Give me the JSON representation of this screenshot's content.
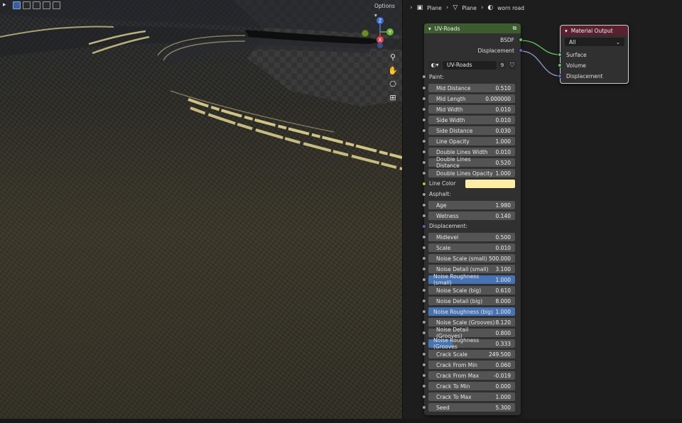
{
  "viewport": {
    "options_label": "Options",
    "gizmo_axes": {
      "z": "Z",
      "y": "Y",
      "x": "X"
    },
    "tool_icons": [
      "zoom-icon",
      "hand-icon",
      "camera-icon",
      "grid-icon"
    ]
  },
  "breadcrumb": {
    "object": "Plane",
    "mesh": "Plane",
    "material": "worn road"
  },
  "uv_node": {
    "title": "UV-Roads",
    "outputs": [
      "BSDF",
      "Displacement"
    ],
    "datablock_name": "UV-Roads",
    "datablock_users": "9",
    "section_paint": "Paint:",
    "paint_fields": [
      {
        "label": "Mid Distance",
        "value": "0.510"
      },
      {
        "label": "Mid Length",
        "value": "0.000000"
      },
      {
        "label": "Mid Width",
        "value": "0.010"
      },
      {
        "label": "Side Width",
        "value": "0.010"
      },
      {
        "label": "Side Distance",
        "value": "0.030"
      },
      {
        "label": "Line Opacity",
        "value": "1.000"
      },
      {
        "label": "Double Lines Width",
        "value": "0.010"
      },
      {
        "label": "Double Lines Distance",
        "value": "0.520"
      },
      {
        "label": "Double Lines Opacity",
        "value": "1.000"
      }
    ],
    "line_color_label": "Line Color",
    "line_color_value": "#ffeda5",
    "section_asphalt": "Asphalt:",
    "asphalt_fields": [
      {
        "label": "Age",
        "value": "1.980"
      },
      {
        "label": "Wetness",
        "value": "0.140"
      }
    ],
    "section_displacement": "Displacement:",
    "displacement_fields": [
      {
        "label": "Midlevel",
        "value": "0.500"
      },
      {
        "label": "Scale",
        "value": "0.010"
      },
      {
        "label": "Noise Scale (small)",
        "value": "500.000"
      },
      {
        "label": "Noise Detail (small)",
        "value": "3.100"
      },
      {
        "label": "Noise Roughness (small)",
        "value": "1.000"
      },
      {
        "label": "Noise Scale (big)",
        "value": "0.610"
      },
      {
        "label": "Noise Detail (big)",
        "value": "8.000"
      },
      {
        "label": "Noise Roughness (big)",
        "value": "1.000"
      },
      {
        "label": "Noise Scale (Grooves)",
        "value": "8.120"
      },
      {
        "label": "Noise Detail (Grooves)",
        "value": "0.800"
      },
      {
        "label": "Noise Roughness (Grooves",
        "value": "0.333"
      },
      {
        "label": "Crack Scale",
        "value": "249.500"
      },
      {
        "label": "Crack From Min",
        "value": "0.060"
      },
      {
        "label": "Crack From Max",
        "value": "-0.019"
      },
      {
        "label": "Crack To Min",
        "value": "0.000"
      },
      {
        "label": "Crack To Max",
        "value": "1.000"
      },
      {
        "label": "Seed",
        "value": "5.300"
      }
    ]
  },
  "material_output": {
    "title": "Material Output",
    "target": "All",
    "inputs": [
      "Surface",
      "Volume",
      "Displacement"
    ]
  },
  "colors": {
    "uv_header": "#3c5c2f",
    "output_header": "#5a2030",
    "highlight": "#4772b3",
    "shader_socket": "#63c763",
    "vector_socket": "#6363c7"
  }
}
